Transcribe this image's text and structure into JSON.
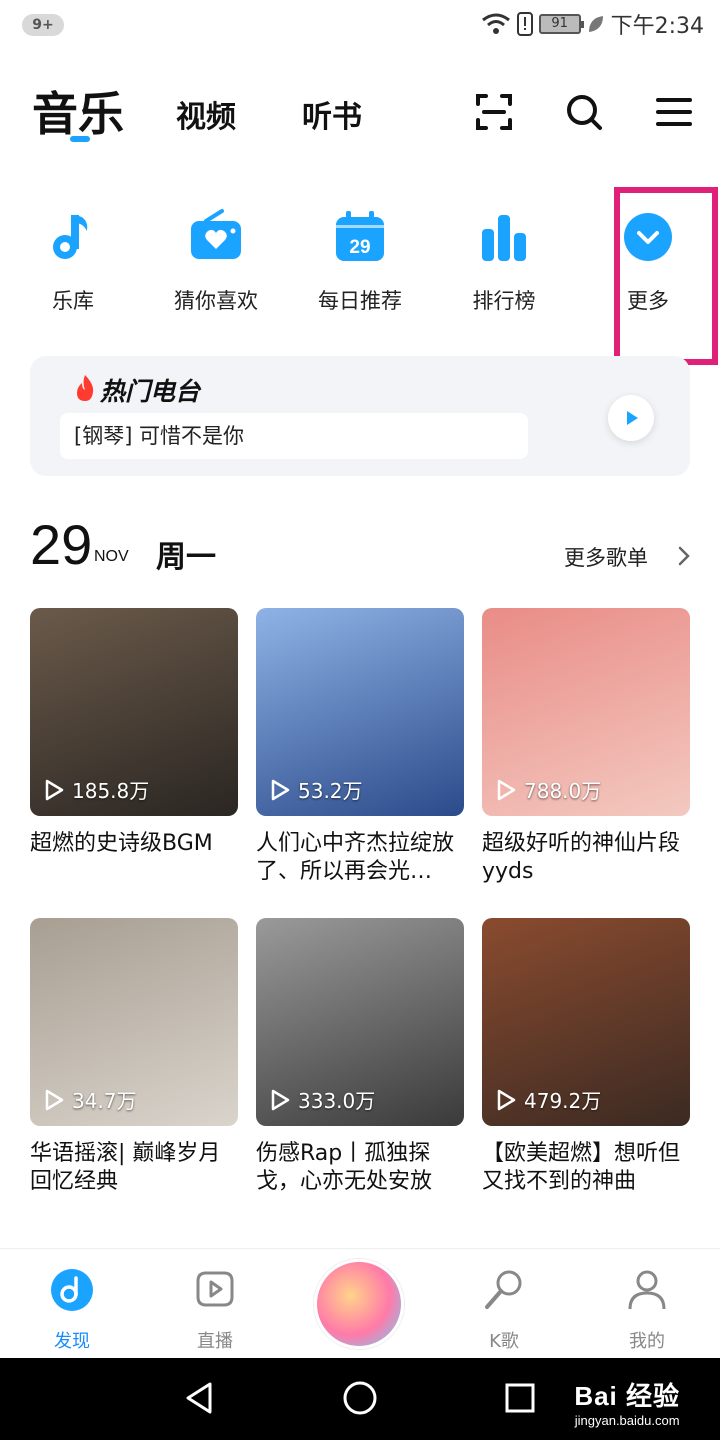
{
  "status_bar": {
    "notification_count": "9+",
    "battery": "91",
    "time": "下午2:34",
    "icons": [
      "wifi-icon",
      "alert-icon",
      "battery-icon",
      "leaf-icon"
    ]
  },
  "top_nav": {
    "tabs": [
      {
        "label": "音乐",
        "active": true
      },
      {
        "label": "视频",
        "active": false
      },
      {
        "label": "听书",
        "active": false
      }
    ],
    "icons": [
      "scan-icon",
      "search-icon",
      "menu-icon"
    ],
    "accent": "#1aa3ff"
  },
  "quick_entries": [
    {
      "label": "乐库",
      "icon": "music-note-icon"
    },
    {
      "label": "猜你喜欢",
      "icon": "heart-radio-icon"
    },
    {
      "label": "每日推荐",
      "icon": "calendar-icon",
      "icon_text": "29"
    },
    {
      "label": "排行榜",
      "icon": "bar-chart-icon"
    },
    {
      "label": "更多",
      "icon": "chevron-down-icon"
    }
  ],
  "hot_radio": {
    "title": "热门电台",
    "current_song": "[钢琴] 可惜不是你"
  },
  "daily": {
    "day": "29",
    "month": "NOV",
    "weekday": "周一",
    "more_label": "更多歌单"
  },
  "playlists": [
    {
      "title": "超燃的史诗级BGM",
      "plays": "185.8万",
      "cover_colors": [
        "#2a2622",
        "#6b5a4a"
      ]
    },
    {
      "title": "人们心中齐杰拉绽放了、所以再会光…",
      "plays": "53.2万",
      "cover_colors": [
        "#2b4a8a",
        "#8fb3e6"
      ]
    },
    {
      "title": "超级好听的神仙片段yyds",
      "plays": "788.0万",
      "cover_colors": [
        "#f3c9c0",
        "#e98c86"
      ]
    },
    {
      "title": "华语摇滚| 巅峰岁月回忆经典",
      "plays": "34.7万",
      "cover_colors": [
        "#d9d4cc",
        "#a89e92"
      ]
    },
    {
      "title": "伤感Rap丨孤独探戈，心亦无处安放",
      "plays": "333.0万",
      "cover_colors": [
        "#3a3a3a",
        "#9a9a9a"
      ]
    },
    {
      "title": "【欧美超燃】想听但又找不到的神曲",
      "plays": "479.2万",
      "cover_colors": [
        "#3b2a22",
        "#8a4b2f"
      ]
    }
  ],
  "bottom_tabs": [
    {
      "label": "发现",
      "icon": "discover-icon",
      "active": true
    },
    {
      "label": "直播",
      "icon": "live-icon",
      "active": false
    },
    {
      "label": "",
      "icon": "center-disc-icon",
      "active": false
    },
    {
      "label": "K歌",
      "icon": "microphone-icon",
      "active": false
    },
    {
      "label": "我的",
      "icon": "profile-icon",
      "active": false
    }
  ],
  "watermark": {
    "logo": "Bai 经验",
    "url": "jingyan.baidu.com"
  }
}
